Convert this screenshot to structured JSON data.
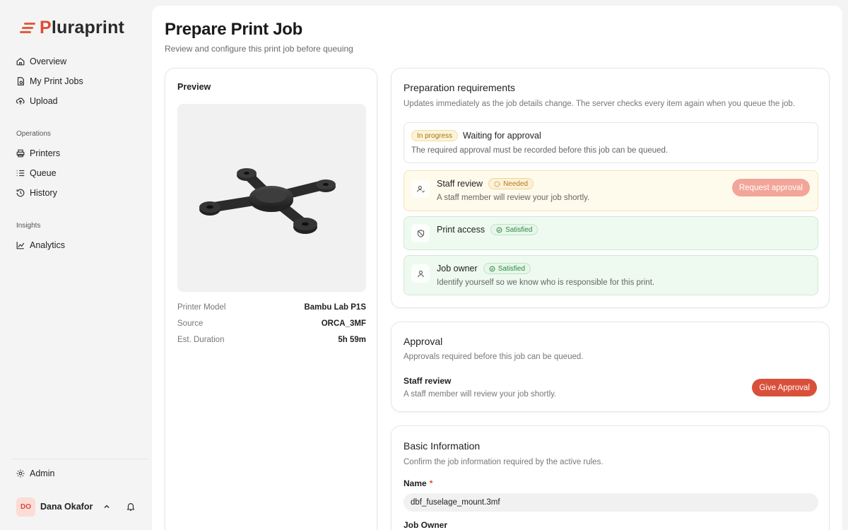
{
  "brand": {
    "name_prefix": "P",
    "name_rest": "luraprint",
    "accent_color": "#e04a34"
  },
  "sidebar": {
    "primary": [
      {
        "label": "Overview",
        "icon": "home-icon"
      },
      {
        "label": "My Print Jobs",
        "icon": "print-jobs-icon"
      },
      {
        "label": "Upload",
        "icon": "upload-icon"
      }
    ],
    "operations_title": "Operations",
    "operations": [
      {
        "label": "Printers",
        "icon": "printer-icon"
      },
      {
        "label": "Queue",
        "icon": "queue-icon"
      },
      {
        "label": "History",
        "icon": "history-icon"
      }
    ],
    "insights_title": "Insights",
    "insights": [
      {
        "label": "Analytics",
        "icon": "analytics-icon"
      }
    ],
    "admin_label": "Admin",
    "user": {
      "initials": "DO",
      "name": "Dana Okafor"
    }
  },
  "page": {
    "title": "Prepare Print Job",
    "subtitle": "Review and configure this print job before queuing"
  },
  "preview": {
    "title": "Preview",
    "meta": [
      {
        "label": "Printer Model",
        "value": "Bambu Lab P1S"
      },
      {
        "label": "Source",
        "value": "ORCA_3MF"
      },
      {
        "label": "Est. Duration",
        "value": "5h 59m"
      }
    ]
  },
  "requirements": {
    "title": "Preparation requirements",
    "subtitle": "Updates immediately as the job details change. The server checks every item again when you queue the job.",
    "status": {
      "badge": "In progress",
      "title": "Waiting for approval",
      "description": "The required approval must be recorded before this job can be queued."
    },
    "rules": [
      {
        "name": "Staff review",
        "badge": "Needed",
        "description": "A staff member will review your job shortly.",
        "action": "Request approval"
      },
      {
        "name": "Print access",
        "badge": "Satisfied",
        "description": ""
      },
      {
        "name": "Job owner",
        "badge": "Satisfied",
        "description": "Identify yourself so we know who is responsible for this print."
      }
    ]
  },
  "approval": {
    "title": "Approval",
    "subtitle": "Approvals required before this job can be queued.",
    "item_name": "Staff review",
    "item_description": "A staff member will review your job shortly.",
    "button": "Give Approval"
  },
  "basic": {
    "title": "Basic Information",
    "subtitle": "Confirm the job information required by the active rules.",
    "name_label": "Name",
    "name_required_marker": "*",
    "name_value": "dbf_fuselage_mount.3mf",
    "owner_label": "Job Owner"
  }
}
